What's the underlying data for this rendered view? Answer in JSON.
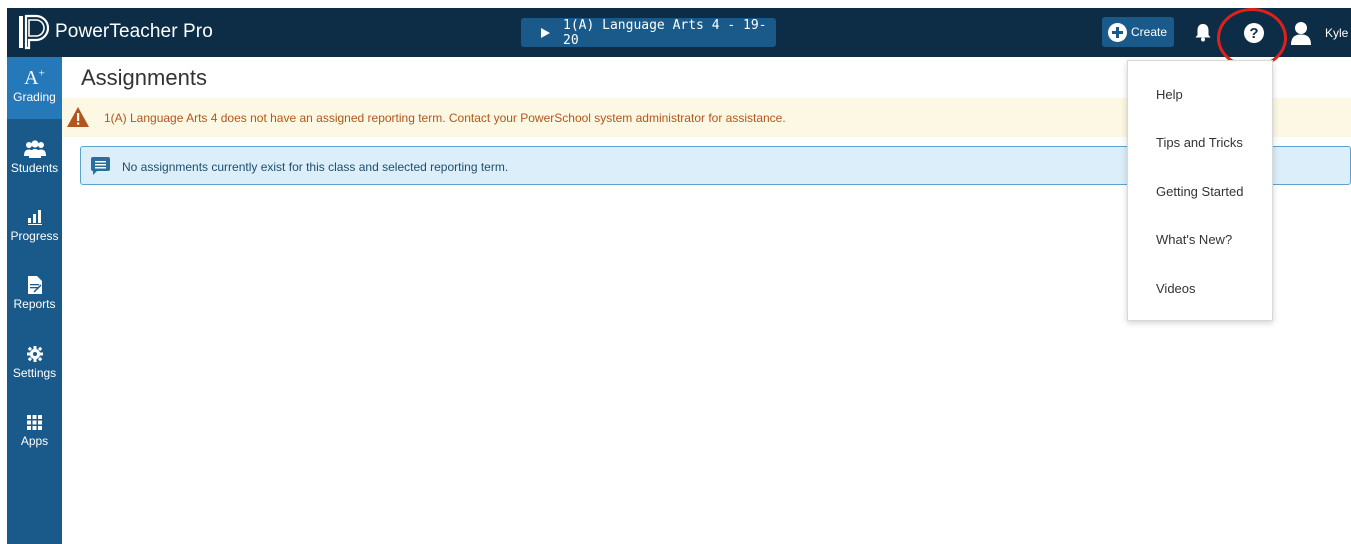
{
  "app": {
    "title": "PowerTeacher Pro",
    "class_selector": "1(A) Language Arts 4  - 19-20",
    "create_label": "Create",
    "user_name": "Kyle"
  },
  "sidebar": {
    "items": [
      {
        "label": "Grading",
        "icon": "grading-icon",
        "active": true
      },
      {
        "label": "Students",
        "icon": "students-icon"
      },
      {
        "label": "Progress",
        "icon": "progress-icon"
      },
      {
        "label": "Reports",
        "icon": "reports-icon"
      },
      {
        "label": "Settings",
        "icon": "gear-icon"
      },
      {
        "label": "Apps",
        "icon": "apps-grid-icon"
      }
    ]
  },
  "main": {
    "title": "Assignments",
    "warning": "1(A) Language Arts 4 does not have an assigned reporting term. Contact your PowerSchool system administrator for assistance.",
    "info": "No assignments currently exist for this class and selected reporting term."
  },
  "help_menu": {
    "items": [
      "Help",
      "Tips and Tricks",
      "Getting Started",
      "What's New?",
      "Videos"
    ]
  },
  "colors": {
    "topbar": "#0d2d47",
    "sidebar": "#1a5a8a",
    "sidebar_active": "#2579b8",
    "warning_bg": "#fcf8e3",
    "warning_text": "#b3561d",
    "info_bg": "#dbeef9",
    "highlight_ring": "#e0201b"
  }
}
